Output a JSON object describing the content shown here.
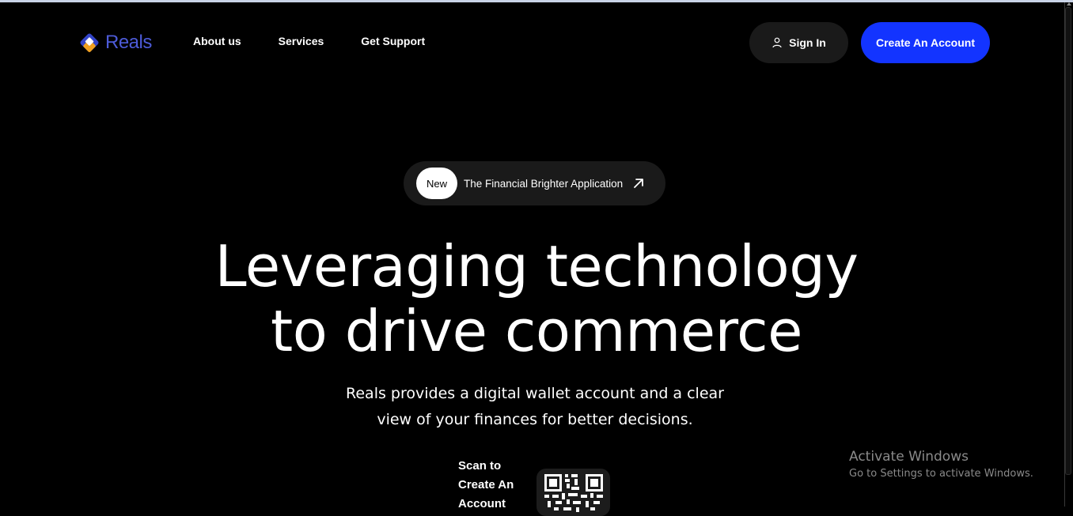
{
  "header": {
    "logo_text": "Reals",
    "nav": [
      "About us",
      "Services",
      "Get Support"
    ],
    "signin_label": "Sign In",
    "create_label": "Create An Account"
  },
  "badge": {
    "tag": "New",
    "text": "The Financial Brighter Application"
  },
  "hero": {
    "headline_line1": "Leveraging technology",
    "headline_line2": "to drive commerce",
    "subtitle_line1": "Reals provides a digital wallet account and a clear",
    "subtitle_line2": "view of your finances for better decisions."
  },
  "scan": {
    "line1": "Scan to",
    "line2": "Create An",
    "line3": "Account"
  },
  "watermark": {
    "title": "Activate Windows",
    "subtitle": "Go to Settings to activate Windows."
  },
  "colors": {
    "accent": "#1334ff",
    "logo": "#4d5bd8",
    "background": "#000000"
  },
  "icons": {
    "logo": "reals-logo-icon",
    "user": "user-icon",
    "arrow": "arrow-up-right-icon",
    "qr": "qr-code-icon"
  }
}
